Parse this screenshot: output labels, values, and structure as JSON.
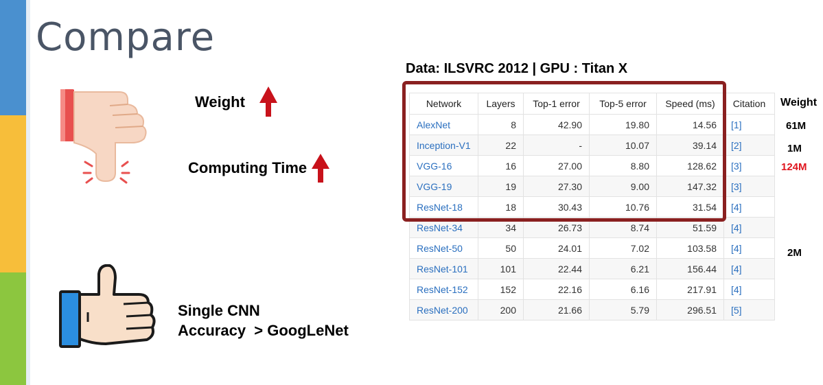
{
  "slide": {
    "title": "Compare",
    "weight_label": "Weight",
    "computing_time_label": "Computing Time",
    "cnn_line1": "Single CNN",
    "cnn_line2": "Accuracy  > GoogLeNet",
    "data_caption": "Data: ILSVRC 2012 | GPU : Titan X"
  },
  "colors": {
    "arrow_red": "#c8121b",
    "highlight_border": "#8a2020",
    "link_blue": "#2a6fbf",
    "weight_red": "#e0161f"
  },
  "icons": {
    "thumbs_down": "thumbs-down-icon",
    "thumbs_up": "thumbs-up-icon",
    "up_arrow": "up-arrow-icon"
  },
  "table": {
    "headers": [
      "Network",
      "Layers",
      "Top-1 error",
      "Top-5 error",
      "Speed (ms)",
      "Citation"
    ],
    "rows": [
      [
        "AlexNet",
        "8",
        "42.90",
        "19.80",
        "14.56",
        "[1]"
      ],
      [
        "Inception-V1",
        "22",
        "-",
        "10.07",
        "39.14",
        "[2]"
      ],
      [
        "VGG-16",
        "16",
        "27.00",
        "8.80",
        "128.62",
        "[3]"
      ],
      [
        "VGG-19",
        "19",
        "27.30",
        "9.00",
        "147.32",
        "[3]"
      ],
      [
        "ResNet-18",
        "18",
        "30.43",
        "10.76",
        "31.54",
        "[4]"
      ],
      [
        "ResNet-34",
        "34",
        "26.73",
        "8.74",
        "51.59",
        "[4]"
      ],
      [
        "ResNet-50",
        "50",
        "24.01",
        "7.02",
        "103.58",
        "[4]"
      ],
      [
        "ResNet-101",
        "101",
        "22.44",
        "6.21",
        "156.44",
        "[4]"
      ],
      [
        "ResNet-152",
        "152",
        "22.16",
        "6.16",
        "217.91",
        "[4]"
      ],
      [
        "ResNet-200",
        "200",
        "21.66",
        "5.79",
        "296.51",
        "[5]"
      ]
    ]
  },
  "weights": {
    "header": "Weight",
    "alexnet": "61M",
    "inception": "1M",
    "vgg16": "124M",
    "resnet50": "2M"
  }
}
